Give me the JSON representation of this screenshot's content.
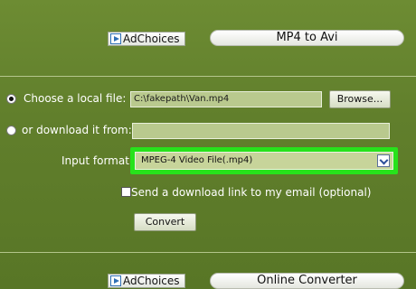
{
  "top": {
    "adchoices_label": "AdChoices",
    "pill_title": "MP4 to Avi"
  },
  "form": {
    "local_file_label": "Choose a local file:",
    "local_file_value": "C:\\fakepath\\Van.mp4",
    "browse_label": "Browse...",
    "download_label": "or download it from:",
    "download_value": "",
    "input_format_label": "Input format:",
    "input_format_value": "MPEG-4 Video File(.mp4)",
    "email_label": "Send a download link to my email (optional)",
    "convert_label": "Convert",
    "local_file_selected": true,
    "email_checked": false
  },
  "bottom": {
    "adchoices_label": "AdChoices",
    "pill_title": "Online Converter"
  },
  "colors": {
    "background": "#617f2c",
    "highlight": "#27e21b",
    "field": "#b9c98e"
  },
  "icons": [
    "adchoices-icon",
    "chevron-down-icon"
  ]
}
